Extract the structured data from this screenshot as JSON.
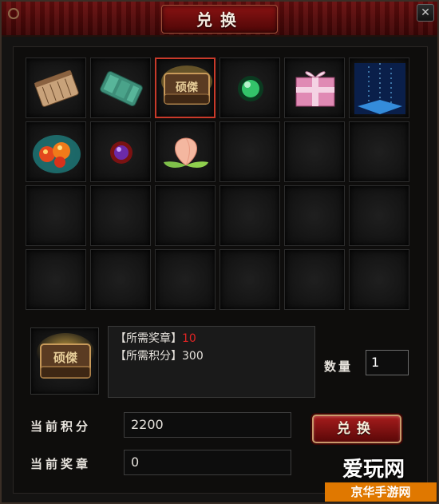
{
  "window": {
    "title": "兑换",
    "close_symbol": "✕"
  },
  "items": [
    {
      "icon": "scroll-bundle-icon",
      "selected": false
    },
    {
      "icon": "jade-fragments-icon",
      "selected": false
    },
    {
      "icon": "treasure-chest-icon",
      "selected": true,
      "label": "硕傑"
    },
    {
      "icon": "green-pearl-icon",
      "selected": false
    },
    {
      "icon": "gift-box-icon",
      "selected": false
    },
    {
      "icon": "blue-crystal-icon",
      "selected": false
    },
    {
      "icon": "fire-orbs-icon",
      "selected": false
    },
    {
      "icon": "purple-orb-icon",
      "selected": false
    },
    {
      "icon": "peach-icon",
      "selected": false
    }
  ],
  "selected_item": {
    "icon": "treasure-chest-icon",
    "label": "硕傑"
  },
  "requirements": {
    "medal_label": "【所需奖章】",
    "medal_value": "10",
    "points_label": "【所需积分】",
    "points_value": "300"
  },
  "quantity": {
    "label": "数量",
    "value": "1"
  },
  "current_points": {
    "label": "当前积分",
    "value": "2200"
  },
  "current_medals": {
    "label": "当前奖章",
    "value": "0"
  },
  "exchange_button": "兑换",
  "watermark": {
    "main": "爱玩网",
    "sub": "京华手游网"
  },
  "colors": {
    "title_red": "#6a0e0e",
    "required_value_red": "#e02424",
    "selected_border": "#c93a2a",
    "watermark_orange": "#e07800"
  }
}
